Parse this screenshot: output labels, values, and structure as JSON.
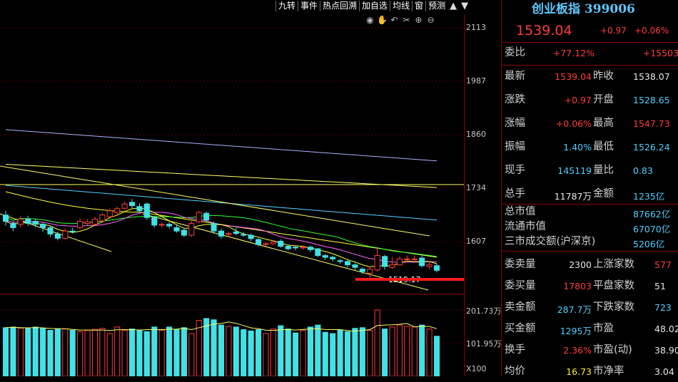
{
  "toolbar": {
    "items": [
      "九转",
      "事件",
      "热点回溯",
      "加自选",
      "均线",
      "窗",
      "预测"
    ],
    "controls": [
      "▲",
      "▼"
    ]
  },
  "view_icons": [
    "eye-icon",
    "hand-icon",
    "undo-icon",
    "scissors-icon",
    "zoom-in-icon",
    "zoom-out-icon"
  ],
  "y_axis": {
    "price_ticks": [
      "2113",
      "1987",
      "1860",
      "1734",
      "1607"
    ],
    "volume_ticks": [
      "201.73万",
      "101.95万",
      "X100"
    ]
  },
  "chart_labels": {
    "low_marker": "1519.17"
  },
  "colors": {
    "up": "#ff3b3b",
    "down": "#41e1e6",
    "ma5": "#ffffff",
    "ma10": "#ffff33",
    "ma20": "#ff66ff",
    "ma30": "#33ff33",
    "ma60": "#ffff66",
    "ma120": "#4fd0ff",
    "ma250": "#aab0ff",
    "border": "#8b0000"
  },
  "panel": {
    "title": "创业板指 399006",
    "price": "1539.04",
    "change": "+0.97",
    "change_pct": "+0.06%",
    "webi": {
      "label": "委比",
      "value": "+77.12%",
      "value2": "+15503"
    },
    "rows": [
      {
        "l1": "最新",
        "v1": "1539.04",
        "l2": "昨收",
        "v2": "1538.07"
      },
      {
        "l1": "涨跌",
        "v1": "+0.97",
        "l2": "开盘",
        "v2": "1528.65"
      },
      {
        "l1": "涨幅",
        "v1": "+0.06%",
        "l2": "最高",
        "v2": "1547.73"
      },
      {
        "l1": "振幅",
        "v1": "1.40%",
        "l2": "最低",
        "v2": "1526.24"
      },
      {
        "l1": "现手",
        "v1": "145119",
        "l2": "量比",
        "v2": "0.83"
      },
      {
        "l1": "总手",
        "v1": "11787万",
        "l2": "金额",
        "v2": "1235亿"
      }
    ],
    "market": [
      {
        "label": "总市值",
        "value": "87662亿"
      },
      {
        "label": "流通市值",
        "value": "67070亿"
      },
      {
        "label": "三市成交额(沪深京)",
        "value": "5206亿"
      }
    ],
    "stats": [
      {
        "l1": "委卖量",
        "v1": "2300",
        "l2": "上涨家数",
        "v2": "577"
      },
      {
        "l1": "委买量",
        "v1": "17803",
        "l2": "平盘家数",
        "v2": "51"
      },
      {
        "l1": "卖金额",
        "v1": "287.7万",
        "l2": "下跌家数",
        "v2": "723"
      },
      {
        "l1": "买金额",
        "v1": "1295万",
        "l2": "市盈",
        "v2": "48.02"
      },
      {
        "l1": "换手",
        "v1": "2.36%",
        "l2": "市盈(动)",
        "v2": "38.90"
      },
      {
        "l1": "均价",
        "v1": "16.73",
        "l2": "市净率",
        "v2": "3.04"
      }
    ]
  },
  "chart_data": {
    "type": "candlestick",
    "y_axis_ticks": [
      2113,
      1987,
      1860,
      1734,
      1607
    ],
    "volume_axis_ticks": [
      "201.73万",
      "101.95万"
    ],
    "candles": [
      {
        "o": 1670,
        "c": 1655,
        "h": 1680,
        "l": 1645
      },
      {
        "o": 1650,
        "c": 1640,
        "h": 1656,
        "l": 1632
      },
      {
        "o": 1648,
        "c": 1660,
        "h": 1668,
        "l": 1640
      },
      {
        "o": 1660,
        "c": 1650,
        "h": 1668,
        "l": 1644
      },
      {
        "o": 1655,
        "c": 1648,
        "h": 1662,
        "l": 1640
      },
      {
        "o": 1648,
        "c": 1640,
        "h": 1652,
        "l": 1630
      },
      {
        "o": 1640,
        "c": 1625,
        "h": 1645,
        "l": 1618
      },
      {
        "o": 1625,
        "c": 1615,
        "h": 1630,
        "l": 1610
      },
      {
        "o": 1615,
        "c": 1632,
        "h": 1638,
        "l": 1612
      },
      {
        "o": 1632,
        "c": 1630,
        "h": 1640,
        "l": 1626
      },
      {
        "o": 1640,
        "c": 1655,
        "h": 1662,
        "l": 1636
      },
      {
        "o": 1650,
        "c": 1654,
        "h": 1660,
        "l": 1646
      },
      {
        "o": 1648,
        "c": 1660,
        "h": 1666,
        "l": 1644
      },
      {
        "o": 1656,
        "c": 1670,
        "h": 1675,
        "l": 1652
      },
      {
        "o": 1666,
        "c": 1680,
        "h": 1686,
        "l": 1660
      },
      {
        "o": 1676,
        "c": 1685,
        "h": 1690,
        "l": 1670
      },
      {
        "o": 1686,
        "c": 1696,
        "h": 1702,
        "l": 1682
      },
      {
        "o": 1700,
        "c": 1692,
        "h": 1708,
        "l": 1686
      },
      {
        "o": 1690,
        "c": 1680,
        "h": 1698,
        "l": 1676
      },
      {
        "o": 1696,
        "c": 1664,
        "h": 1700,
        "l": 1658
      },
      {
        "o": 1664,
        "c": 1646,
        "h": 1668,
        "l": 1640
      },
      {
        "o": 1646,
        "c": 1648,
        "h": 1652,
        "l": 1640
      },
      {
        "o": 1648,
        "c": 1644,
        "h": 1654,
        "l": 1638
      },
      {
        "o": 1640,
        "c": 1632,
        "h": 1648,
        "l": 1628
      },
      {
        "o": 1634,
        "c": 1622,
        "h": 1640,
        "l": 1618
      },
      {
        "o": 1622,
        "c": 1650,
        "h": 1656,
        "l": 1618
      },
      {
        "o": 1654,
        "c": 1676,
        "h": 1680,
        "l": 1650
      },
      {
        "o": 1674,
        "c": 1658,
        "h": 1678,
        "l": 1652
      },
      {
        "o": 1650,
        "c": 1632,
        "h": 1654,
        "l": 1626
      },
      {
        "o": 1632,
        "c": 1620,
        "h": 1638,
        "l": 1614
      },
      {
        "o": 1624,
        "c": 1626,
        "h": 1630,
        "l": 1618
      },
      {
        "o": 1630,
        "c": 1626,
        "h": 1640,
        "l": 1622
      },
      {
        "o": 1624,
        "c": 1622,
        "h": 1630,
        "l": 1618
      },
      {
        "o": 1622,
        "c": 1614,
        "h": 1626,
        "l": 1608
      },
      {
        "o": 1612,
        "c": 1600,
        "h": 1616,
        "l": 1596
      },
      {
        "o": 1600,
        "c": 1602,
        "h": 1606,
        "l": 1596
      },
      {
        "o": 1602,
        "c": 1606,
        "h": 1610,
        "l": 1598
      },
      {
        "o": 1608,
        "c": 1596,
        "h": 1612,
        "l": 1592
      },
      {
        "o": 1596,
        "c": 1590,
        "h": 1600,
        "l": 1586
      },
      {
        "o": 1594,
        "c": 1592,
        "h": 1598,
        "l": 1586
      },
      {
        "o": 1592,
        "c": 1594,
        "h": 1598,
        "l": 1588
      },
      {
        "o": 1594,
        "c": 1588,
        "h": 1598,
        "l": 1582
      },
      {
        "o": 1590,
        "c": 1574,
        "h": 1592,
        "l": 1570
      },
      {
        "o": 1574,
        "c": 1570,
        "h": 1578,
        "l": 1564
      },
      {
        "o": 1570,
        "c": 1566,
        "h": 1574,
        "l": 1560
      },
      {
        "o": 1562,
        "c": 1560,
        "h": 1566,
        "l": 1554
      },
      {
        "o": 1560,
        "c": 1552,
        "h": 1564,
        "l": 1546
      },
      {
        "o": 1552,
        "c": 1546,
        "h": 1556,
        "l": 1540
      },
      {
        "o": 1542,
        "c": 1536,
        "h": 1546,
        "l": 1530
      },
      {
        "o": 1532,
        "c": 1542,
        "h": 1548,
        "l": 1519
      },
      {
        "o": 1540,
        "c": 1574,
        "h": 1594,
        "l": 1536
      },
      {
        "o": 1572,
        "c": 1548,
        "h": 1576,
        "l": 1540
      },
      {
        "o": 1546,
        "c": 1552,
        "h": 1570,
        "l": 1542
      },
      {
        "o": 1552,
        "c": 1566,
        "h": 1572,
        "l": 1550
      },
      {
        "o": 1566,
        "c": 1566,
        "h": 1574,
        "l": 1560
      },
      {
        "o": 1566,
        "c": 1566,
        "h": 1574,
        "l": 1560
      },
      {
        "o": 1568,
        "c": 1550,
        "h": 1576,
        "l": 1546
      },
      {
        "o": 1548,
        "c": 1552,
        "h": 1560,
        "l": 1542
      },
      {
        "o": 1550,
        "c": 1539,
        "h": 1556,
        "l": 1534
      }
    ],
    "volumes": [
      148,
      150,
      146,
      146,
      150,
      146,
      140,
      144,
      144,
      140,
      136,
      140,
      143,
      146,
      130,
      150,
      140,
      144,
      140,
      136,
      150,
      140,
      150,
      142,
      148,
      130,
      170,
      176,
      172,
      156,
      152,
      150,
      142,
      138,
      142,
      130,
      144,
      154,
      144,
      132,
      140,
      150,
      156,
      134,
      130,
      140,
      136,
      146,
      148,
      140,
      202,
      144,
      150,
      156,
      152,
      150,
      156,
      144,
      122
    ]
  }
}
